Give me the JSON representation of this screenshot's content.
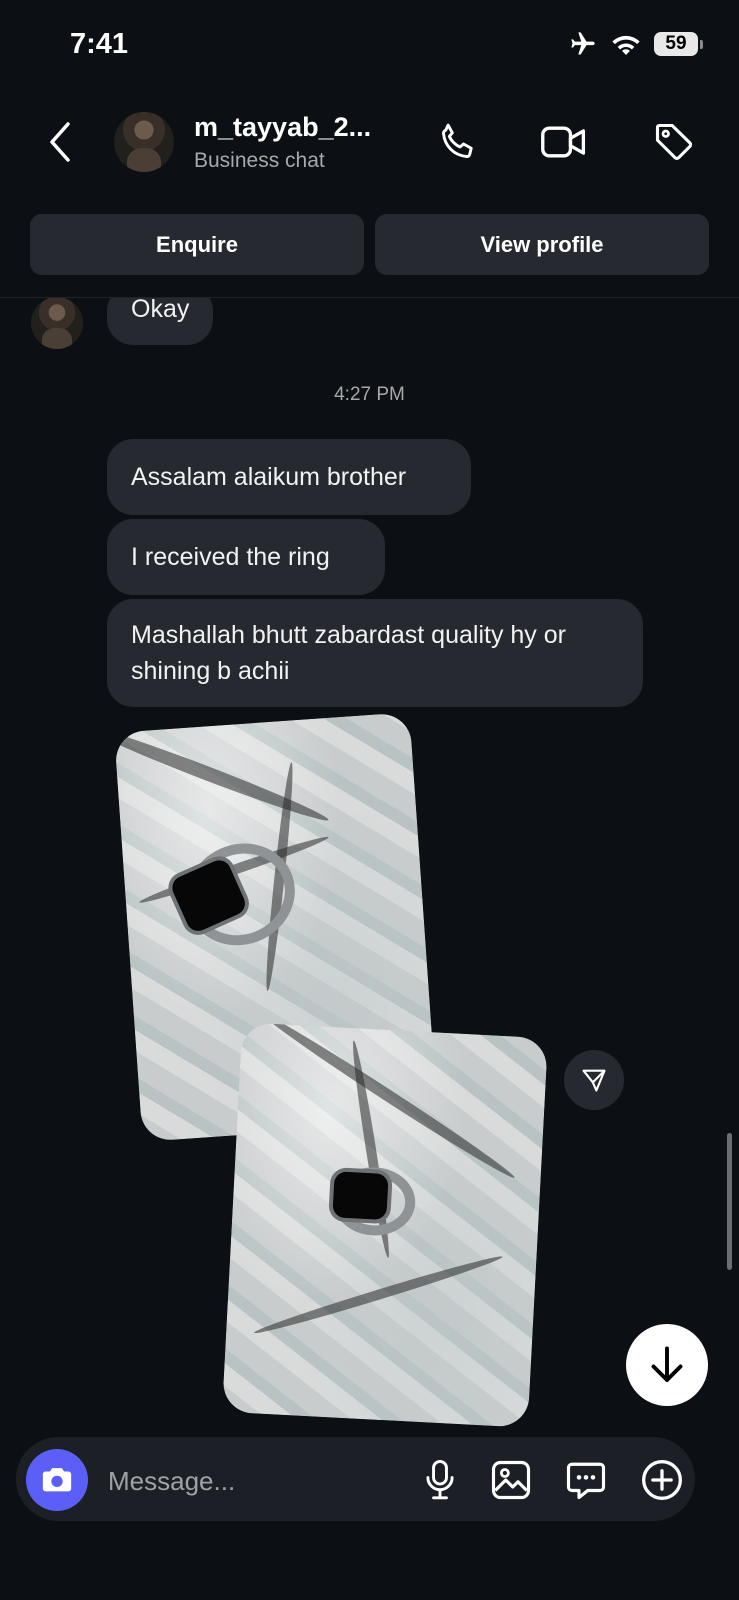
{
  "status_bar": {
    "time": "7:41",
    "battery": "59"
  },
  "header": {
    "username": "m_tayyab_2...",
    "subtitle": "Business chat",
    "enquire_label": "Enquire",
    "view_profile_label": "View profile"
  },
  "messages": {
    "prev_received": "Okay",
    "timestamp": "4:27 PM",
    "sent": [
      "Assalam alaikum brother",
      "I received the ring",
      "Mashallah bhutt zabardast  quality hy or shining b achii"
    ]
  },
  "composer": {
    "placeholder": "Message..."
  },
  "colors": {
    "background": "#0c1014",
    "bubble": "#262a30",
    "accent": "#5b5ff5"
  }
}
